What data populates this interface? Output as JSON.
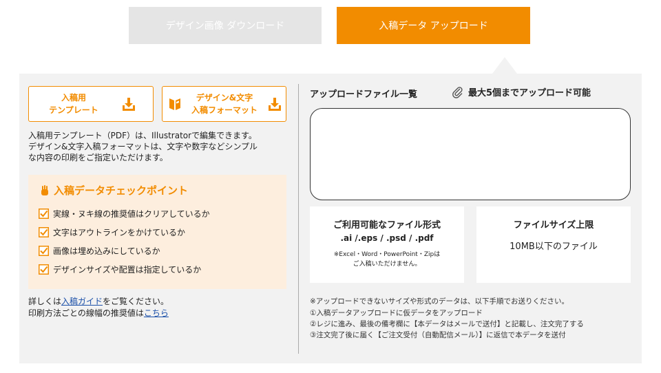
{
  "tabs": {
    "download_label": "デザイン画像 ダウンロード",
    "upload_label": "入稿データ アップロード"
  },
  "buttons": {
    "template": {
      "line1": "入稿用",
      "line2": "テンプレート"
    },
    "design_format": {
      "line1": "デザイン&文字",
      "line2": "入稿フォーマット"
    }
  },
  "description": {
    "line1": "入稿用テンプレート（PDF）は、Illustratorで編集できます。",
    "line2": "デザイン&文字入稿フォーマットは、文字や数字などシンプル",
    "line3": "な内容の印刷をご指定いただけます。"
  },
  "checkpoints": {
    "title": "入稿データチェックポイント",
    "items": [
      "実線・ヌキ線の推奨値はクリアしているか",
      "文字はアウトラインをかけているか",
      "画像は埋め込みにしているか",
      "デザインサイズや配置は指定しているか"
    ]
  },
  "footer": {
    "line1_pre": "詳しくは",
    "line1_link": "入稿ガイド",
    "line1_post": "をご覧ください。",
    "line2_pre": "印刷方法ごとの線幅の推奨値は",
    "line2_link": "こちら"
  },
  "upload": {
    "title": "アップロードファイル一覧",
    "max_note": "最大5個までアップロード可能"
  },
  "formats": {
    "title": "ご利用可能なファイル形式",
    "extensions": ".ai /.eps / .psd / .pdf",
    "note_line1": "※Excel・Word・PowerPoint・Zipは",
    "note_line2": "ご入稿いただけません。"
  },
  "size_limit": {
    "title": "ファイルサイズ上限",
    "value": "10MB以下のファイル"
  },
  "notes": {
    "lead": "※アップロードできないサイズや形式のデータは、以下手順でお送りください。",
    "steps": [
      "①入稿データアップロードに仮データをアップロード",
      "②レジに進み、最後の備考欄に【本データはメールで送付】と記載し、注文完了する",
      "③注文完了後に届く【ご注文受付（自動配信メール）】に返信で本データを送付"
    ]
  },
  "colors": {
    "accent": "#f28c00",
    "panel_bg": "#f2f2f2",
    "tab_inactive": "#e5e5e5",
    "checkbox_bg": "#fdeede",
    "link": "#1a4fa8"
  }
}
